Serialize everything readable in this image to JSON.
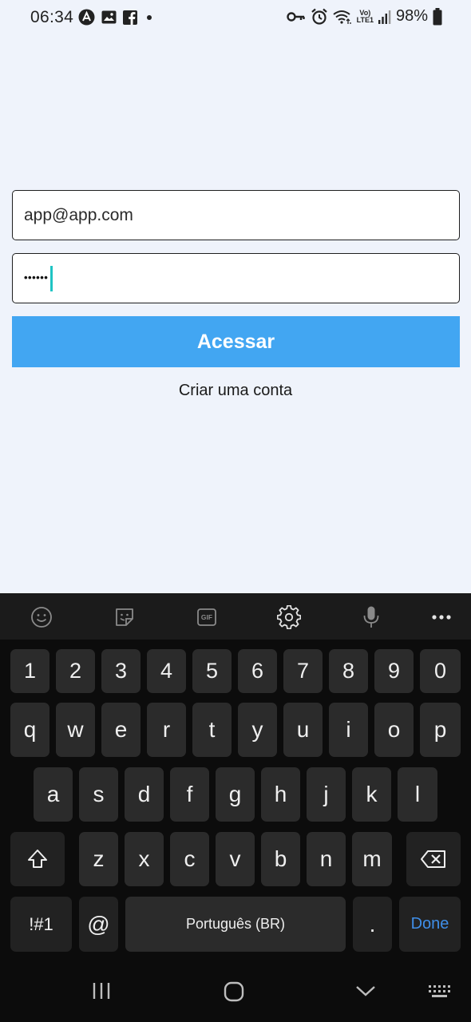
{
  "status_bar": {
    "time": "06:34",
    "battery_text": "98%",
    "left_icons": [
      "app-notification-icon",
      "gallery-icon",
      "facebook-icon",
      "more-notifications-dot"
    ],
    "right_icons": [
      "vpn-key-icon",
      "alarm-icon",
      "wifi-icon",
      "volte-icon",
      "signal-icon",
      "battery-icon"
    ],
    "volte_label_top": "Vo)",
    "volte_label_bottom": "LTE1"
  },
  "login_form": {
    "email_value": "app@app.com",
    "password_mask": "••••••",
    "submit_label": "Acessar",
    "create_account_label": "Criar uma conta",
    "accent_color": "#42a6f2"
  },
  "keyboard": {
    "toolbar": [
      "emoji-icon",
      "sticker-icon",
      "gif-icon",
      "settings-icon",
      "mic-icon",
      "more-icon"
    ],
    "gif_label": "GIF",
    "row_numbers": [
      "1",
      "2",
      "3",
      "4",
      "5",
      "6",
      "7",
      "8",
      "9",
      "0"
    ],
    "row_top": [
      "q",
      "w",
      "e",
      "r",
      "t",
      "y",
      "u",
      "i",
      "o",
      "p"
    ],
    "row_middle": [
      "a",
      "s",
      "d",
      "f",
      "g",
      "h",
      "j",
      "k",
      "l"
    ],
    "row_bottom": [
      "z",
      "x",
      "c",
      "v",
      "b",
      "n",
      "m"
    ],
    "symbols_label": "!#1",
    "at_label": "@",
    "space_label": "Português (BR)",
    "period_label": ".",
    "done_label": "Done",
    "done_color": "#3f8ee8"
  }
}
